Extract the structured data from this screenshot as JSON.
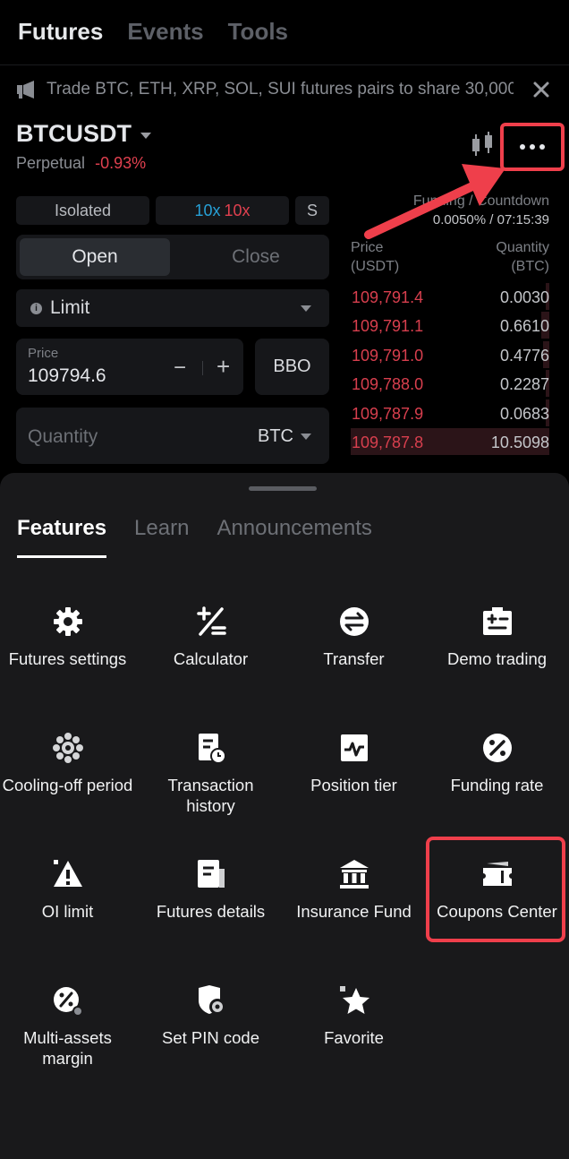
{
  "top_tabs": [
    "Futures",
    "Events",
    "Tools"
  ],
  "announcement": "Trade BTC, ETH, XRP, SOL, SUI futures pairs to share 30,000...",
  "pair": {
    "symbol": "BTCUSDT",
    "type": "Perpetual",
    "change": "-0.93%"
  },
  "order_form": {
    "margin_mode": "Isolated",
    "leverage_long": "10x",
    "leverage_short": "10x",
    "position_mode": "S",
    "open_label": "Open",
    "close_label": "Close",
    "order_type": "Limit",
    "price_label": "Price",
    "price_value": "109794.6",
    "minus": "−",
    "plus": "+",
    "bbo_label": "BBO",
    "quantity_placeholder": "Quantity",
    "quantity_unit": "BTC"
  },
  "funding": {
    "label": "Funding / Countdown",
    "value": "0.0050% / 07:15:39"
  },
  "orderbook": {
    "price_header": "Price\n(USDT)",
    "quantity_header": "Quantity\n(BTC)",
    "asks": [
      {
        "price": "109,791.4",
        "qty": "0.0030",
        "depth": 0.02
      },
      {
        "price": "109,791.1",
        "qty": "0.6610",
        "depth": 0.04
      },
      {
        "price": "109,791.0",
        "qty": "0.4776",
        "depth": 0.03
      },
      {
        "price": "109,788.0",
        "qty": "0.2287",
        "depth": 0.02
      },
      {
        "price": "109,787.9",
        "qty": "0.0683",
        "depth": 0.02
      },
      {
        "price": "109,787.8",
        "qty": "10.5098",
        "depth": 1.0
      }
    ]
  },
  "sheet": {
    "tabs": [
      "Features",
      "Learn",
      "Announcements"
    ],
    "features": [
      {
        "label": "Futures settings",
        "icon": "gear-icon"
      },
      {
        "label": "Calculator",
        "icon": "calculator-icon"
      },
      {
        "label": "Transfer",
        "icon": "transfer-icon"
      },
      {
        "label": "Demo trading",
        "icon": "demo-trading-icon"
      },
      {
        "label": "Cooling-off period",
        "icon": "cooling-off-icon"
      },
      {
        "label": "Transaction history",
        "icon": "transaction-history-icon"
      },
      {
        "label": "Position tier",
        "icon": "position-tier-icon"
      },
      {
        "label": "Funding rate",
        "icon": "funding-rate-icon"
      },
      {
        "label": "OI limit",
        "icon": "warning-icon"
      },
      {
        "label": "Futures details",
        "icon": "document-icon"
      },
      {
        "label": "Insurance Fund",
        "icon": "bank-icon"
      },
      {
        "label": "Coupons Center",
        "icon": "ticket-icon"
      },
      {
        "label": "Multi-assets margin",
        "icon": "multi-assets-icon"
      },
      {
        "label": "Set PIN code",
        "icon": "shield-gear-icon"
      },
      {
        "label": "Favorite",
        "icon": "star-icon"
      }
    ]
  },
  "colors": {
    "background": "#000000",
    "sheet": "#19191b",
    "sell_red": "#d83f4e",
    "highlight": "#ef3f4b",
    "leverage_blue": "#27a0d6"
  }
}
